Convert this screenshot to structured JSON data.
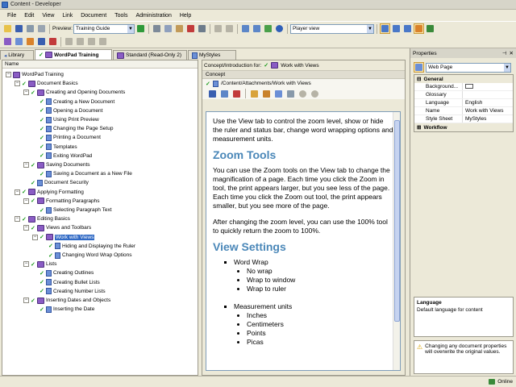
{
  "window": {
    "title": "Content - Developer"
  },
  "menu": [
    "File",
    "Edit",
    "View",
    "Link",
    "Document",
    "Tools",
    "Administration",
    "Help"
  ],
  "toolbar": {
    "preview_label": "Preview:",
    "preview_value": "Training Guide",
    "player_value": "Player view"
  },
  "tabs": [
    {
      "label": "Library",
      "active": false
    },
    {
      "label": "WordPad Training",
      "active": true
    },
    {
      "label": "Standard (Read-Only 2)",
      "active": false
    },
    {
      "label": "MyStyles",
      "active": false
    }
  ],
  "tree": {
    "column_header": "Name",
    "items": [
      {
        "label": "WordPad Training",
        "depth": 0,
        "icon": "book-icon",
        "checked": false
      },
      {
        "label": "Document Basics",
        "depth": 1,
        "icon": "book-icon",
        "checked": true
      },
      {
        "label": "Creating and Opening Documents",
        "depth": 2,
        "icon": "book-icon",
        "checked": true
      },
      {
        "label": "Creating a New Document",
        "depth": 3,
        "icon": "doc-icon",
        "checked": true
      },
      {
        "label": "Opening a Document",
        "depth": 3,
        "icon": "doc-icon",
        "checked": true
      },
      {
        "label": "Using Print Preview",
        "depth": 3,
        "icon": "doc-icon",
        "checked": true
      },
      {
        "label": "Changing the Page Setup",
        "depth": 3,
        "icon": "doc-icon",
        "checked": true
      },
      {
        "label": "Printing a Document",
        "depth": 3,
        "icon": "doc-icon",
        "checked": true
      },
      {
        "label": "Templates",
        "depth": 3,
        "icon": "doc-icon",
        "checked": true
      },
      {
        "label": "Exiting WordPad",
        "depth": 3,
        "icon": "doc-icon",
        "checked": true
      },
      {
        "label": "Saving Documents",
        "depth": 2,
        "icon": "book-icon",
        "checked": true
      },
      {
        "label": "Saving a Document as a New File",
        "depth": 3,
        "icon": "doc-icon",
        "checked": true
      },
      {
        "label": "Document Security",
        "depth": 2,
        "icon": "doc-icon",
        "checked": true
      },
      {
        "label": "Applying Formatting",
        "depth": 1,
        "icon": "book-icon",
        "checked": true
      },
      {
        "label": "Formatting Paragraphs",
        "depth": 2,
        "icon": "book-icon",
        "checked": true
      },
      {
        "label": "Selecting Paragraph Text",
        "depth": 3,
        "icon": "doc-icon",
        "checked": true
      },
      {
        "label": "Editing Basics",
        "depth": 1,
        "icon": "book-icon",
        "checked": true
      },
      {
        "label": "Views and Toolbars",
        "depth": 2,
        "icon": "book-icon",
        "checked": true
      },
      {
        "label": "Work with Views",
        "depth": 3,
        "icon": "book-icon",
        "checked": true,
        "selected": true
      },
      {
        "label": "Hiding and Displaying the Ruler",
        "depth": 4,
        "icon": "doc-icon",
        "checked": true
      },
      {
        "label": "Changing Word Wrap Options",
        "depth": 4,
        "icon": "doc-icon",
        "checked": true
      },
      {
        "label": "Lists",
        "depth": 2,
        "icon": "book-icon",
        "checked": true
      },
      {
        "label": "Creating Outlines",
        "depth": 3,
        "icon": "doc-icon",
        "checked": true
      },
      {
        "label": "Creating Bullet Lists",
        "depth": 3,
        "icon": "doc-icon",
        "checked": true
      },
      {
        "label": "Creating Number Lists",
        "depth": 3,
        "icon": "doc-icon",
        "checked": true
      },
      {
        "label": "Inserting Dates and Objects",
        "depth": 2,
        "icon": "book-icon",
        "checked": true
      },
      {
        "label": "Inserting the Date",
        "depth": 3,
        "icon": "doc-icon",
        "checked": true
      }
    ]
  },
  "concept": {
    "intro_label": "Concept/Introduction for:",
    "intro_value": "Work with Views",
    "panel_label": "Concept",
    "path": "/Content/Attachments/Work with Views"
  },
  "document": {
    "intro": "Use the View tab to control the zoom level, show or hide the ruler and status bar, change word wrapping options and measurement units.",
    "zoom_heading": "Zoom Tools",
    "zoom_p1": "You can use the Zoom tools on the View tab to change the magnification of a page. Each time you click the Zoom in tool, the print appears larger, but you see less of the page. Each time you click the Zoom out tool, the print appears smaller, but you see more of the page.",
    "zoom_p2": "After changing the zoom level, you can use the 100% tool to quickly return the zoom to 100%.",
    "view_heading": "View Settings",
    "word_wrap": "Word Wrap",
    "word_wrap_items": [
      "No wrap",
      "Wrap to window",
      "Wrap to ruler"
    ],
    "units": "Measurement units",
    "units_items": [
      "Inches",
      "Centimeters",
      "Points",
      "Picas"
    ]
  },
  "properties": {
    "title": "Properties",
    "object_type": "Web Page",
    "general_label": "General",
    "rows": [
      {
        "key": "Background...",
        "value": ""
      },
      {
        "key": "Glossary",
        "value": ""
      },
      {
        "key": "Language",
        "value": "English"
      },
      {
        "key": "Name",
        "value": "Work with Views"
      },
      {
        "key": "Style Sheet",
        "value": "MyStyles"
      }
    ],
    "workflow_label": "Workflow",
    "desc_title": "Language",
    "desc_text": "Default language for content",
    "warning": "Changing any document properties will overwrite the original values."
  },
  "status": {
    "text": "Online"
  }
}
